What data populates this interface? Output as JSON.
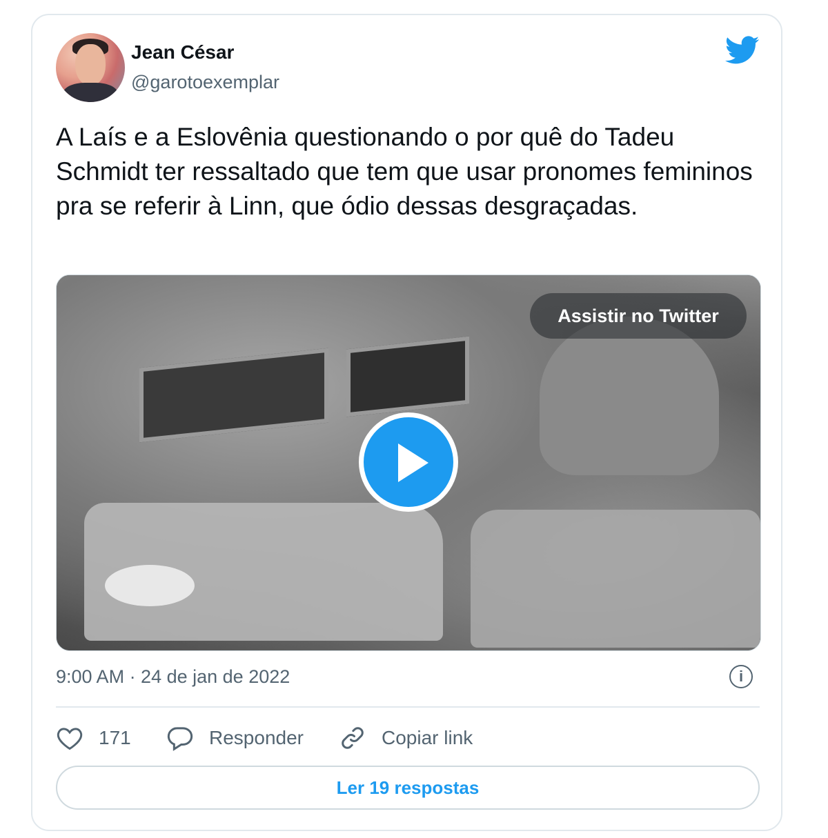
{
  "author": {
    "name": "Jean César",
    "handle": "@garotoexemplar"
  },
  "tweet": {
    "text": "A Laís e a Eslovênia questionando o por quê do Tadeu Schmidt ter ressaltado que tem que usar pronomes femininos pra se referir à Linn, que ódio dessas desgraçadas."
  },
  "media": {
    "watch_label": "Assistir no Twitter"
  },
  "meta": {
    "timestamp": "9:00 AM · 24 de jan de 2022"
  },
  "actions": {
    "likes_count": "171",
    "reply_label": "Responder",
    "copy_link_label": "Copiar link"
  },
  "read_replies_label": "Ler 19 respostas",
  "colors": {
    "accent": "#1d9bf0",
    "text_primary": "#0f1419",
    "text_secondary": "#536471",
    "border": "#e1e8ed"
  },
  "icons": {
    "brand": "twitter-bird-icon",
    "like": "heart-icon",
    "reply": "speech-bubble-icon",
    "copy": "link-icon",
    "info": "info-icon",
    "play": "play-icon"
  }
}
